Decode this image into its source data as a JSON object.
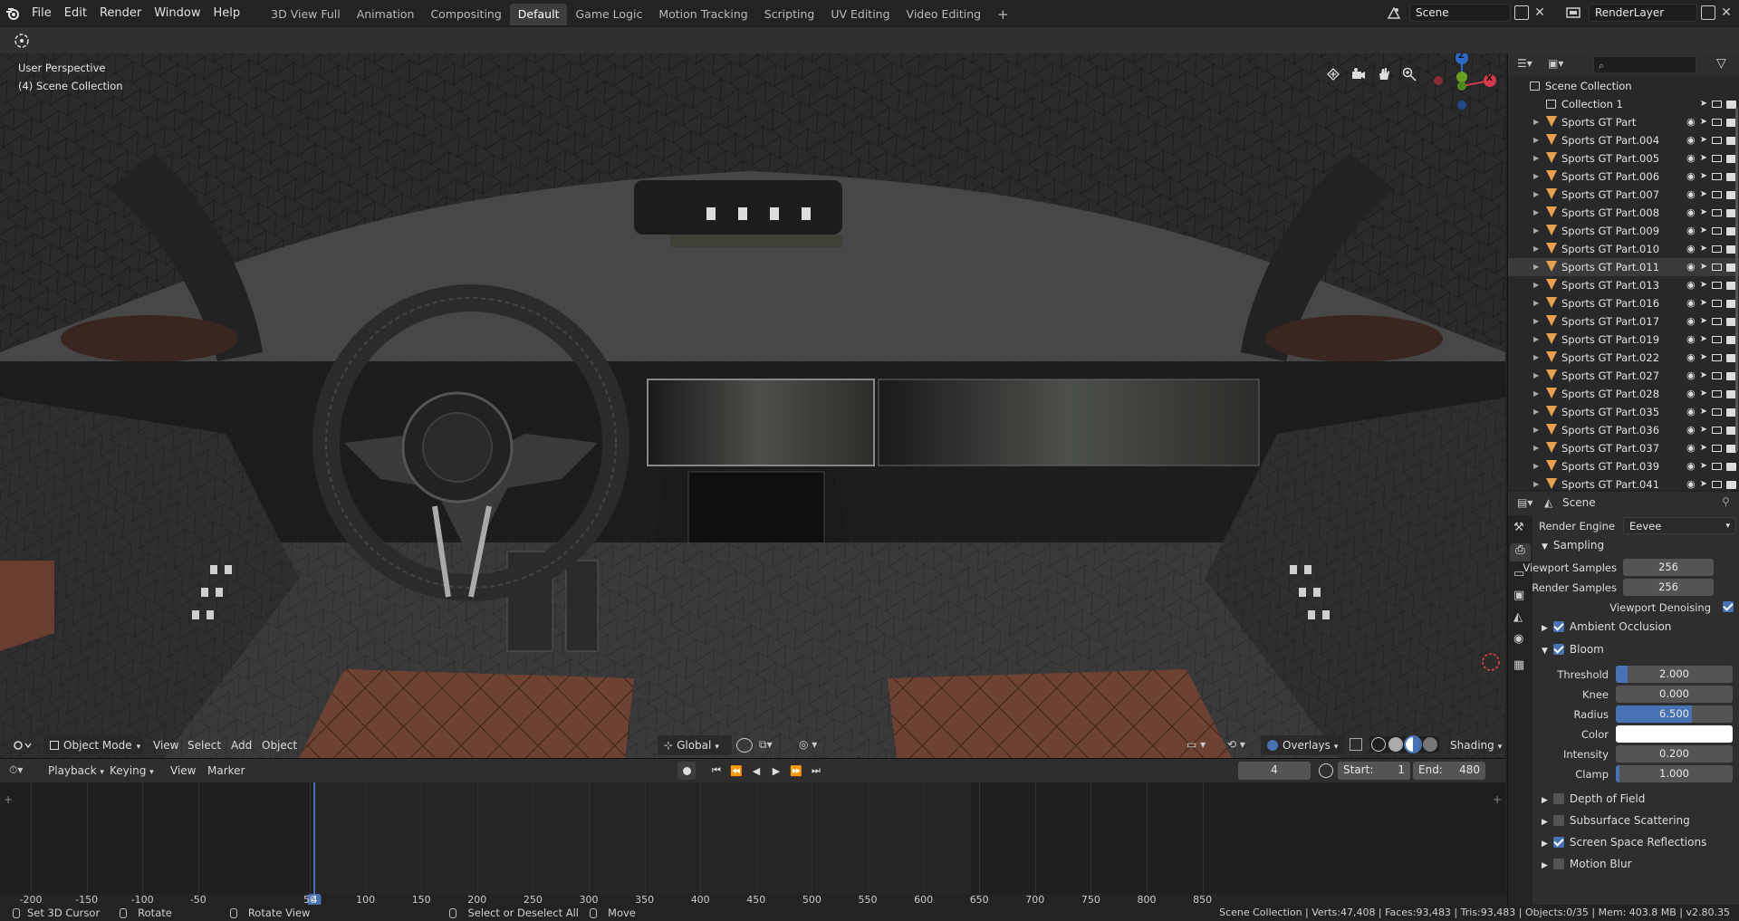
{
  "menu": [
    "File",
    "Edit",
    "Render",
    "Window",
    "Help"
  ],
  "workspaces": [
    {
      "label": "3D View Full",
      "active": false
    },
    {
      "label": "Animation",
      "active": false
    },
    {
      "label": "Compositing",
      "active": false
    },
    {
      "label": "Default",
      "active": true
    },
    {
      "label": "Game Logic",
      "active": false
    },
    {
      "label": "Motion Tracking",
      "active": false
    },
    {
      "label": "Scripting",
      "active": false
    },
    {
      "label": "UV Editing",
      "active": false
    },
    {
      "label": "Video Editing",
      "active": false
    }
  ],
  "add_workspace": "+",
  "scene_name": "Scene",
  "render_layer": "RenderLayer",
  "viewport": {
    "perspective": "User Perspective",
    "collection": "(4) Scene Collection",
    "gizmo": {
      "z": "Z",
      "x": "X"
    },
    "header": {
      "mode": "Object Mode",
      "view": "View",
      "select": "Select",
      "add": "Add",
      "object": "Object",
      "orientation": "Global",
      "overlays": "Overlays",
      "shading": "Shading"
    }
  },
  "outliner": {
    "root": "Scene Collection",
    "collection": "Collection 1",
    "items": [
      {
        "name": "Sports GT Part",
        "selected": false
      },
      {
        "name": "Sports GT Part.004",
        "selected": false
      },
      {
        "name": "Sports GT Part.005",
        "selected": false
      },
      {
        "name": "Sports GT Part.006",
        "selected": false
      },
      {
        "name": "Sports GT Part.007",
        "selected": false
      },
      {
        "name": "Sports GT Part.008",
        "selected": false
      },
      {
        "name": "Sports GT Part.009",
        "selected": false
      },
      {
        "name": "Sports GT Part.010",
        "selected": false
      },
      {
        "name": "Sports GT Part.011",
        "selected": true
      },
      {
        "name": "Sports GT Part.013",
        "selected": false
      },
      {
        "name": "Sports GT Part.016",
        "selected": false
      },
      {
        "name": "Sports GT Part.017",
        "selected": false
      },
      {
        "name": "Sports GT Part.019",
        "selected": false
      },
      {
        "name": "Sports GT Part.022",
        "selected": false
      },
      {
        "name": "Sports GT Part.027",
        "selected": false
      },
      {
        "name": "Sports GT Part.028",
        "selected": false
      },
      {
        "name": "Sports GT Part.035",
        "selected": false
      },
      {
        "name": "Sports GT Part.036",
        "selected": false
      },
      {
        "name": "Sports GT Part.037",
        "selected": false
      },
      {
        "name": "Sports GT Part.039",
        "selected": false
      },
      {
        "name": "Sports GT Part.041",
        "selected": false
      }
    ]
  },
  "properties": {
    "context": "Scene",
    "render_engine_label": "Render Engine",
    "render_engine": "Eevee",
    "sampling": {
      "title": "Sampling",
      "viewport_samples_label": "Viewport Samples",
      "viewport_samples": "256",
      "render_samples_label": "Render Samples",
      "render_samples": "256",
      "denoise_label": "Viewport Denoising",
      "denoise": true
    },
    "ambient_occlusion": {
      "title": "Ambient Occlusion",
      "enabled": true
    },
    "bloom": {
      "title": "Bloom",
      "enabled": true,
      "threshold_label": "Threshold",
      "threshold": "2.000",
      "threshold_fill": 0.1,
      "knee_label": "Knee",
      "knee": "0.000",
      "knee_fill": 0,
      "radius_label": "Radius",
      "radius": "6.500",
      "radius_fill": 0.65,
      "color_label": "Color",
      "color": "#ffffff",
      "intensity_label": "Intensity",
      "intensity": "0.200",
      "intensity_fill": 0,
      "clamp_label": "Clamp",
      "clamp": "1.000",
      "clamp_fill": 0.03
    },
    "depth_of_field": {
      "title": "Depth of Field",
      "enabled": false
    },
    "subsurface": {
      "title": "Subsurface Scattering",
      "enabled": false
    },
    "ssr": {
      "title": "Screen Space Reflections",
      "enabled": true
    },
    "motion_blur": {
      "title": "Motion Blur",
      "enabled": false
    }
  },
  "timeline": {
    "playback": "Playback",
    "keying": "Keying",
    "view": "View",
    "marker": "Marker",
    "current_frame": "4",
    "start_label": "Start:",
    "start": "1",
    "end_label": "End:",
    "end": "480",
    "ruler": [
      "-200",
      "-150",
      "-100",
      "-50",
      "4",
      "50",
      "100",
      "150",
      "200",
      "250",
      "300",
      "350",
      "400",
      "450",
      "500",
      "550",
      "600",
      "650",
      "700",
      "750",
      "800",
      "850"
    ]
  },
  "statusbar": {
    "cursor": "Set 3D Cursor",
    "rotate": "Rotate",
    "rotate_view": "Rotate View",
    "select": "Select or Deselect All",
    "move": "Move",
    "stats": "Scene Collection | Verts:47,408 | Faces:93,483 | Tris:93,483 | Objects:0/35 | Mem: 403.8 MB | v2.80.35"
  },
  "colors": {
    "accent": "#4772b3",
    "selected_row": "#3a3a3a",
    "object_icon": "#e8a050",
    "leather": "#6e4232"
  }
}
